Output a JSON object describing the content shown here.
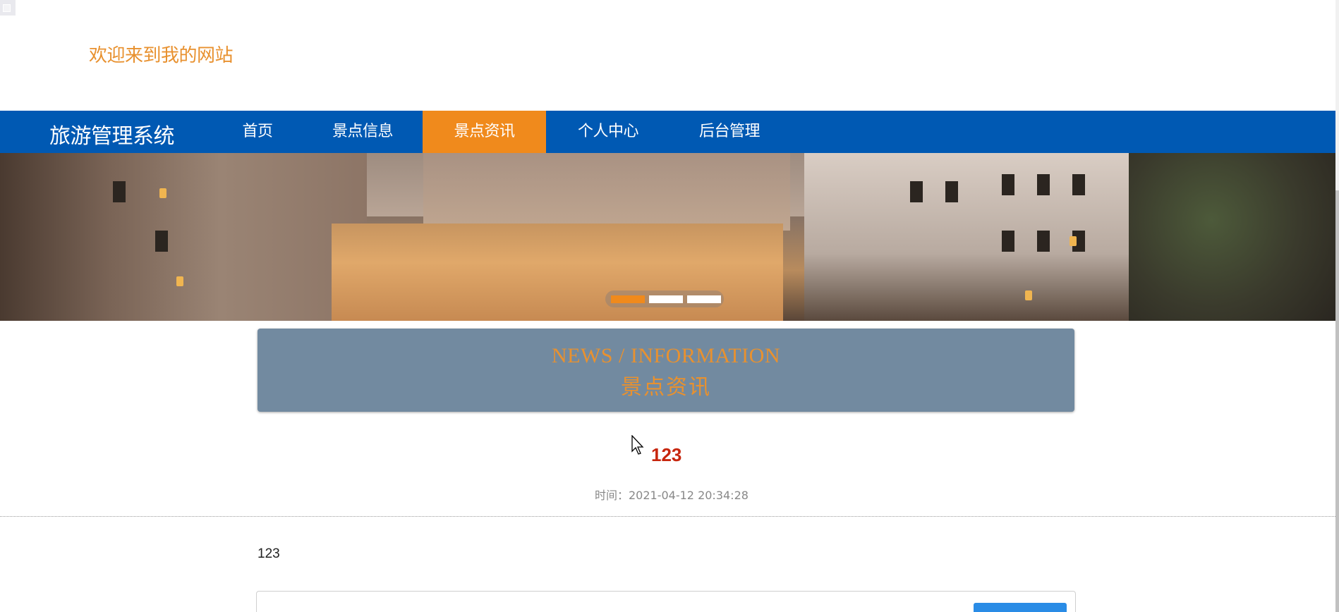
{
  "header": {
    "welcome_text": "欢迎来到我的网站"
  },
  "nav": {
    "brand": "旅游管理系统",
    "items": [
      {
        "label": "首页",
        "active": false
      },
      {
        "label": "景点信息",
        "active": false
      },
      {
        "label": "景点资讯",
        "active": true
      },
      {
        "label": "个人中心",
        "active": false
      },
      {
        "label": "后台管理",
        "active": false
      }
    ]
  },
  "carousel": {
    "slide_count": 3,
    "active_index": 0
  },
  "section_heading": {
    "english": "NEWS / INFORMATION",
    "chinese": "景点资讯"
  },
  "article": {
    "title": "123",
    "time": "时间：2021-04-12 20:34:28",
    "body": "123"
  },
  "colors": {
    "nav_bg": "#0059b3",
    "accent": "#f08a1c",
    "heading_bg": "#728aa0",
    "title_red": "#c7260e",
    "button_blue": "#2a8ce6"
  }
}
